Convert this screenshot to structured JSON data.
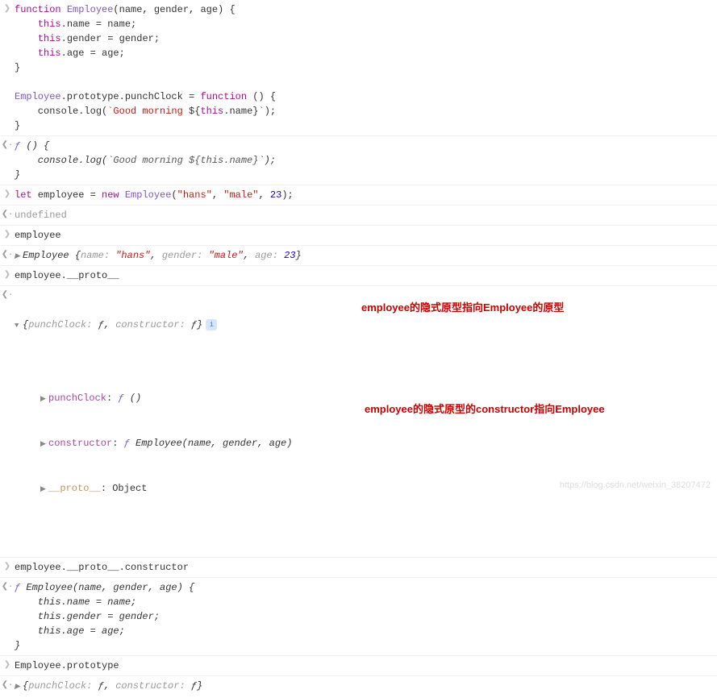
{
  "rows": {
    "r1": "function Employee(name, gender, age) {\n    this.name = name;\n    this.gender = gender;\n    this.age = age;\n}\n\nEmployee.prototype.punchClock = function () {\n    console.log(`Good morning ${this.name}`);\n}",
    "r2": "ƒ () {\n    console.log(`Good morning ${this.name}`);\n}",
    "r3": "let employee = new Employee(\"hans\", \"male\", 23);",
    "r4": "undefined",
    "r5": "employee",
    "r6": "Employee {name: \"hans\", gender: \"male\", age: 23}",
    "r7": "employee.__proto__",
    "r8": "{punchClock: ƒ, constructor: ƒ}",
    "r8_l1_k": "punchClock",
    "r8_l1_v": "ƒ ()",
    "r8_l2_k": "constructor",
    "r8_l2_v": "ƒ Employee(name, gender, age)",
    "r8_l3_k": "__proto__",
    "r8_l3_v": "Object",
    "r9": "employee.__proto__.constructor",
    "r10": "ƒ Employee(name, gender, age) {\n    this.name = name;\n    this.gender = gender;\n    this.age = age;\n}",
    "r11": "Employee.prototype",
    "r12": "{punchClock: ƒ, constructor: ƒ}"
  },
  "annotations": {
    "a1": "employee的隐式原型指向Employee的原型",
    "a2": "employee的隐式原型的constructor指向Employee"
  },
  "watermark": "https://blog.csdn.net/weixin_38207472"
}
